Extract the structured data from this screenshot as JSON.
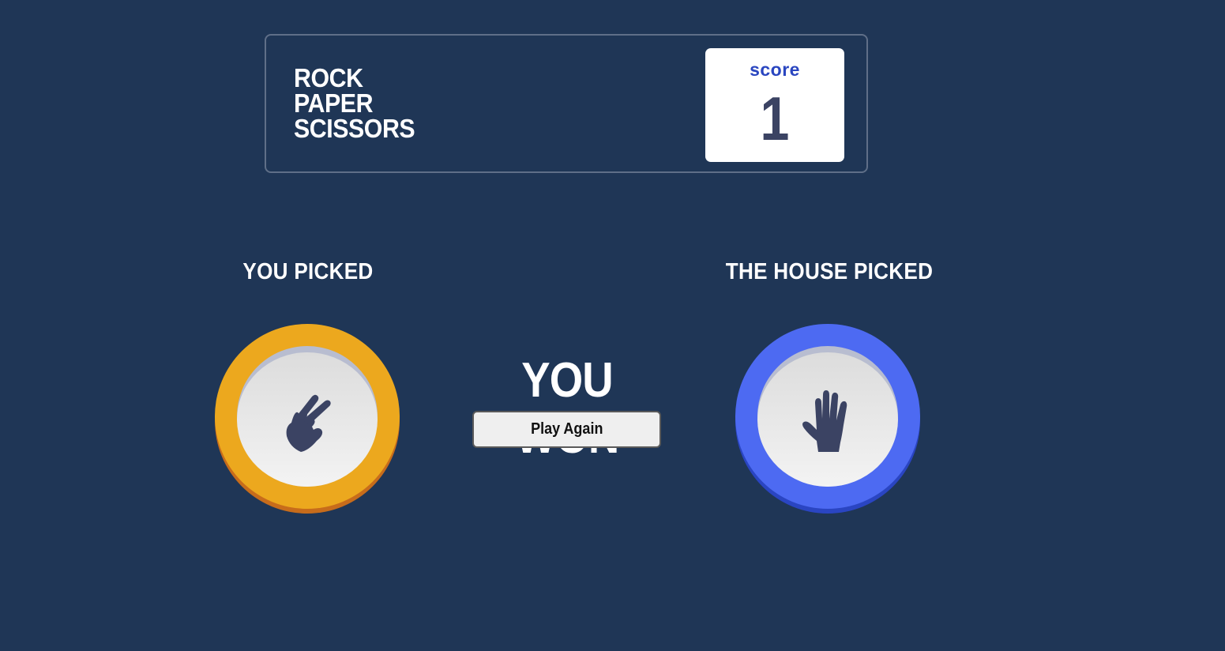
{
  "header": {
    "title_lines": [
      "ROCK",
      "PAPER",
      "SCISSORS"
    ],
    "score_label": "score",
    "score_value": "1"
  },
  "player": {
    "label": "YOU PICKED",
    "choice": "scissors",
    "icon": "scissors-hand-icon",
    "color": "#eca81e"
  },
  "house": {
    "label": "THE HOUSE PICKED",
    "choice": "paper",
    "icon": "paper-hand-icon",
    "color": "#4d6af2"
  },
  "result": {
    "text": "YOU WON",
    "button_label": "Play Again"
  },
  "colors": {
    "background": "#1f3656",
    "score_label": "#2a46c0",
    "score_value": "#3b4363",
    "icon": "#3b4363"
  }
}
